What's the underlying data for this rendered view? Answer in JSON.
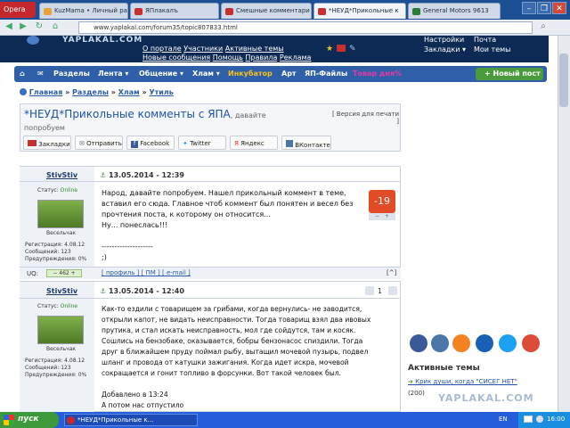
{
  "browser": {
    "app_name": "Opera",
    "tabs": [
      {
        "label": "KuzMama • Личный ра"
      },
      {
        "label": "ЯПлакалъ"
      },
      {
        "label": "Смешные комментари"
      },
      {
        "label": "*НЕУД*Прикольные к"
      },
      {
        "label": "General Motors 9613"
      }
    ],
    "url": "www.yaplakal.com/forum35/topic807833.html",
    "controls": {
      "minimize": "–",
      "maximize": "❐",
      "close": "✕"
    }
  },
  "site": {
    "logo": "YAPLAKAL.COM",
    "header_links_left": [
      "О портале",
      "Участники",
      "Активные темы",
      "Новые сообщения",
      "Помощь",
      "Правила",
      "Реклама"
    ],
    "header_links_right": [
      "Настройки",
      "Закладки ▾",
      "Почта",
      "Мои темы"
    ],
    "menu": [
      "Разделы",
      "Лента ▾",
      "Общение ▾",
      "Хлам ▾",
      "Инкубатор",
      "Арт",
      "ЯП-Файлы",
      "Товар дня%"
    ],
    "new_post": "Новый пост",
    "breadcrumb": [
      "Главная",
      "»",
      "Разделы",
      "»",
      "Хлам",
      "»",
      "Утиль"
    ]
  },
  "topic": {
    "title": "*НЕУД*Прикольные комменты с ЯПА",
    "subtitle": ", давайте попробуем",
    "print_link": "[ Версия для печати ]",
    "share": [
      "Закладки",
      "Отправить",
      "Facebook",
      "Twitter",
      "Яндекс",
      "ВКонтакте"
    ]
  },
  "posts": [
    {
      "username": "StivStiv",
      "date": "13.05.2014 - 12:39",
      "status_label": "Статус:",
      "status_value": "Online",
      "rank": "Весельчак",
      "registration": "Регистрация: 4.08.12",
      "messages": "Сообщений: 123",
      "warnings": "Предупреждения: 0%",
      "text_lines": [
        "Народ, давайте попробуем. Нашел прикольный коммент в теме,",
        "вставил его сюда. Главное чтоб коммент был понятен и весел без",
        "прочтения поста, к которому он относится...",
        "Ну... понеслась!!!",
        "",
        "--------------------",
        ";)"
      ],
      "rating": "-19",
      "uq_label": "UQ:",
      "uq_value": "462",
      "footer_links": "[ профиль ] [ ПМ ] [ e-mail ]",
      "top_link": "[^]"
    },
    {
      "username": "StivStiv",
      "date": "13.05.2014 - 12:40",
      "status_label": "Статус:",
      "status_value": "Online",
      "rank": "Весельчак",
      "registration": "Регистрация: 4.08.12",
      "messages": "Сообщений: 123",
      "warnings": "Предупреждения: 0%",
      "counter": "1",
      "text_lines": [
        "Как-то ездили с товарищем за грибами, когда вернулись- не заводится,",
        "открыли капот, не видать неисправности. Тогда товарищ взял два ивовых",
        "прутика, и стал искать неисправность, мол где сойдутся, там и косяк.",
        "Сошлись на бензобаке, оказывается, бобры бензонасос спиздили. Тогда",
        "друг в ближайшем пруду поймал рыбу, вытащил мочевой пузырь, подвел",
        "шланг и провода от катушки зажигания. Когда идет искра, мочевой",
        "сокращается и гонит топливо в форсунки. Вот такой человек был.",
        "",
        "Добавлено в 13:24",
        "А потом нас отпустило"
      ]
    }
  ],
  "sidebar": {
    "active_title": "Активные темы",
    "active_item": "Крик души, когда \"СИСЕГ НЕТ\"",
    "active_count": "(200)",
    "watermark": "YAPLAKAL.COM"
  },
  "taskbar": {
    "start": "пуск",
    "item": "*НЕУД*Прикольные к...",
    "lang": "EN",
    "time": "16:00"
  }
}
